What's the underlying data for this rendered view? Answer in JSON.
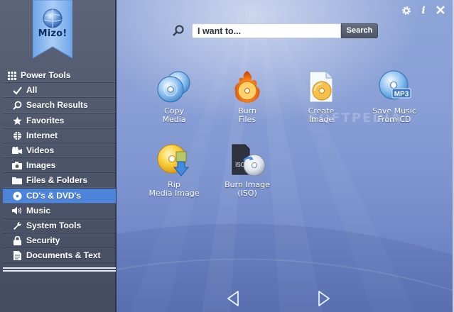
{
  "app": {
    "logo_text": "Mizo!"
  },
  "top_icons": [
    {
      "name": "settings",
      "icon": "gear-icon"
    },
    {
      "name": "info",
      "icon": "info-icon"
    },
    {
      "name": "close",
      "icon": "close-icon"
    }
  ],
  "search": {
    "placeholder": "I want to...",
    "button_label": "Search"
  },
  "watermark": "SOFTPEDIA",
  "sidebar": {
    "header": {
      "label": "Power Tools",
      "icon": "grid-icon"
    },
    "items": [
      {
        "label": "All",
        "icon": "check-icon"
      },
      {
        "label": "Search Results",
        "icon": "search-icon"
      },
      {
        "label": "Favorites",
        "icon": "star-icon"
      },
      {
        "label": "Internet",
        "icon": "globe-icon"
      },
      {
        "label": "Videos",
        "icon": "video-camera-icon"
      },
      {
        "label": "Images",
        "icon": "camera-icon"
      },
      {
        "label": "Files & Folders",
        "icon": "folder-icon"
      },
      {
        "label": "CD's & DVD's",
        "icon": "disc-icon",
        "active": true
      },
      {
        "label": "Music",
        "icon": "speaker-icon"
      },
      {
        "label": "System Tools",
        "icon": "wrench-icon"
      },
      {
        "label": "Security",
        "icon": "lock-icon"
      },
      {
        "label": "Documents & Text",
        "icon": "document-icon"
      }
    ]
  },
  "tiles": [
    {
      "line1": "Copy",
      "line2": "Media",
      "icon": "copy-discs-icon"
    },
    {
      "line1": "Burn",
      "line2": "Files",
      "icon": "burning-disc-icon"
    },
    {
      "line1": "Create",
      "line2": "Image",
      "icon": "create-image-icon"
    },
    {
      "line1": "Save Music",
      "line2": "From CD",
      "icon": "mp3-disc-icon",
      "badge": "MP3"
    },
    {
      "line1": "Rip",
      "line2": "Media Image",
      "icon": "rip-disc-icon"
    },
    {
      "line1": "Burn Image",
      "line2": "(ISO)",
      "icon": "iso-burn-icon",
      "badge": "ISO"
    }
  ],
  "nav": {
    "prev": "left-arrow-icon",
    "next": "right-arrow-icon"
  },
  "colors": {
    "accent": "#4b84d8",
    "sidebar": "#525a6f",
    "main_bg": "#8aa0d6"
  }
}
